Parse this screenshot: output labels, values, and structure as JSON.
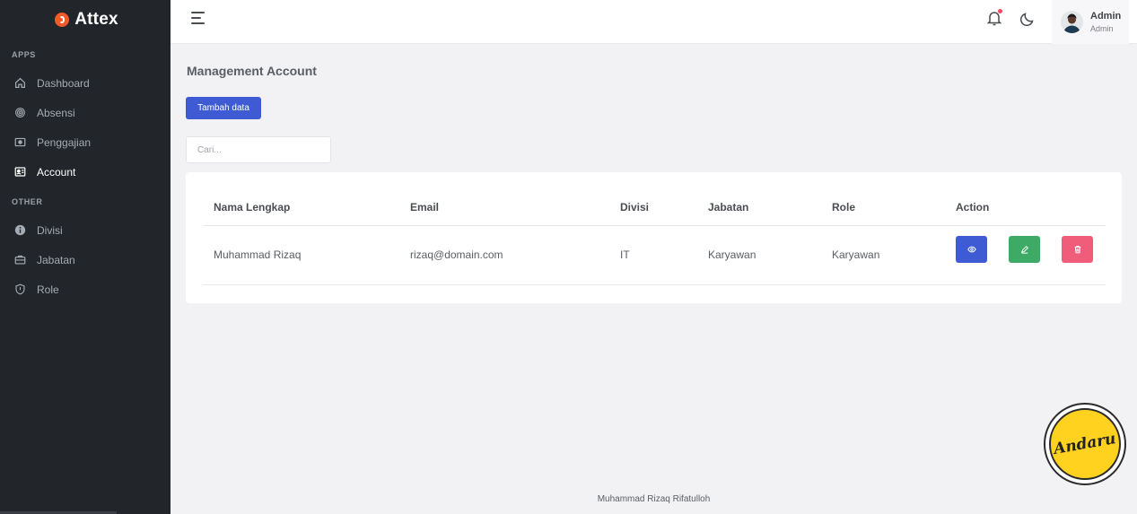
{
  "app": {
    "brand": "Attex"
  },
  "sidebar": {
    "sections": [
      {
        "label": "APPS"
      },
      {
        "label": "OTHER"
      }
    ],
    "apps_items": [
      {
        "label": "Dashboard",
        "icon": "home-icon"
      },
      {
        "label": "Absensi",
        "icon": "fingerprint-icon"
      },
      {
        "label": "Penggajian",
        "icon": "money-icon"
      },
      {
        "label": "Account",
        "icon": "account-icon",
        "active": true
      }
    ],
    "other_items": [
      {
        "label": "Divisi",
        "icon": "info-icon"
      },
      {
        "label": "Jabatan",
        "icon": "briefcase-icon"
      },
      {
        "label": "Role",
        "icon": "shield-icon"
      }
    ]
  },
  "topbar": {
    "user": {
      "name": "Admin",
      "role": "Admin"
    }
  },
  "page": {
    "title": "Management Account",
    "add_button": "Tambah data",
    "search_placeholder": "Cari..."
  },
  "table": {
    "columns": [
      "Nama Lengkap",
      "Email",
      "Divisi",
      "Jabatan",
      "Role",
      "Action"
    ],
    "rows": [
      {
        "name": "Muhammad Rizaq",
        "email": "rizaq@domain.com",
        "divisi": "IT",
        "jabatan": "Karyawan",
        "role": "Karyawan"
      }
    ]
  },
  "footer": {
    "text": "Muhammad Rizaq Rifatulloh"
  },
  "watermark": {
    "text": "Andaru"
  },
  "colors": {
    "sidebar_bg": "#22262b",
    "primary": "#3e5bd4",
    "success": "#3daa66",
    "danger": "#ef5d7a",
    "brand_accent": "#f15a2a"
  }
}
